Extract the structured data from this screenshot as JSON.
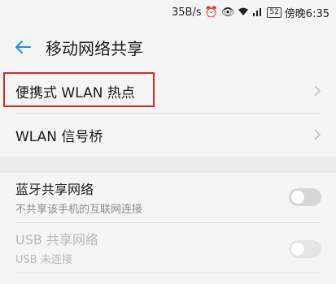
{
  "status_bar": {
    "speed": "35B/s",
    "icons": [
      "alarm-icon",
      "eye-icon",
      "wifi-icon",
      "signal-icon"
    ],
    "battery": "52",
    "time": "傍晚6:35"
  },
  "app_bar": {
    "back_icon": "back-arrow-icon",
    "title": "移动网络共享"
  },
  "items": [
    {
      "label": "便携式 WLAN 热点",
      "icon": "chevron-right-icon"
    },
    {
      "label": "WLAN 信号桥",
      "icon": "chevron-right-icon"
    }
  ],
  "toggles": [
    {
      "label": "蓝牙共享网络",
      "sublabel": "不共享该手机的互联网连接",
      "enabled": true,
      "on": false
    },
    {
      "label": "USB 共享网络",
      "sublabel": "USB 未连接",
      "enabled": false,
      "on": false
    }
  ],
  "colors": {
    "accent": "#1a8df2",
    "highlight": "#d02a2a",
    "background": "#f5f5f5"
  }
}
